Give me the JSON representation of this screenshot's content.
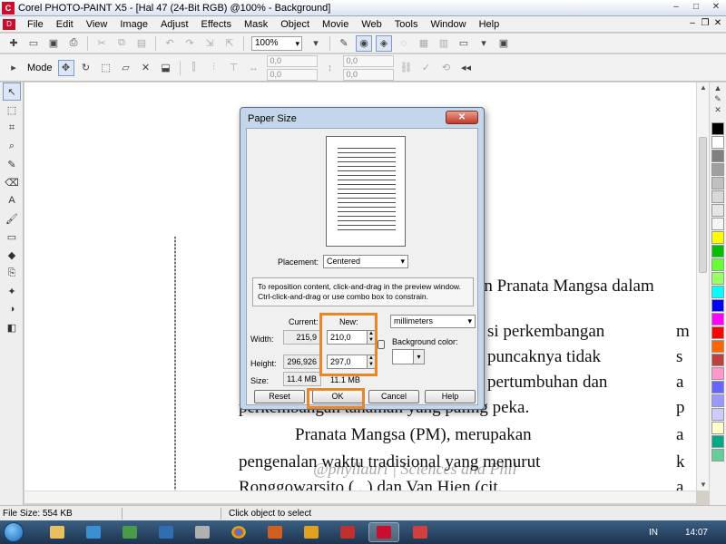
{
  "window": {
    "title": "Corel PHOTO-PAINT X5 - [Hal 47 (24-Bit RGB) @100% - Background]",
    "minimize": "–",
    "maximize": "□",
    "close": "✕"
  },
  "menubar": {
    "items": [
      "File",
      "Edit",
      "View",
      "Image",
      "Adjust",
      "Effects",
      "Mask",
      "Object",
      "Movie",
      "Web",
      "Tools",
      "Window",
      "Help"
    ]
  },
  "toolbar": {
    "zoom": "100%"
  },
  "property_bar": {
    "mode_label": "Mode",
    "x_value": "0,0",
    "y_value": "0,0",
    "w_value": "0,0",
    "h_value": "0,0"
  },
  "document": {
    "lines": [
      "an Pranata Mangsa dalam",
      "si perkembangan",
      "puncaknya tidak",
      "pertumbuhan dan",
      "perkembangan tanaman yang paling peka.",
      "Pranata  Mangsa  (PM),  merupakan",
      "pengenalan  waktu  tradisional  yang  menurut",
      "Ronggowarsito  ( . )  dan  Van  Hien  (cit."
    ],
    "right_column": [
      "m",
      "s",
      "a",
      "p",
      "a",
      "k",
      "a"
    ],
    "watermark": "@phyllauri | Sciences and Phil"
  },
  "dialog": {
    "title": "Paper Size",
    "close": "✕",
    "placement_label": "Placement:",
    "placement_value": "Centered",
    "info_text": "To reposition content, click-and-drag in the preview window. Ctrl-click-and-drag or use combo box to constrain.",
    "current_label": "Current:",
    "new_label": "New:",
    "units_value": "millimeters",
    "width_label": "Width:",
    "height_label": "Height:",
    "size_label": "Size:",
    "current_width": "215,9",
    "current_height": "296,926",
    "current_size": "11.4 MB",
    "new_width": "210,0",
    "new_height": "297,0",
    "new_size": "11.1 MB",
    "background_color_label": "Background color:",
    "buttons": {
      "reset": "Reset",
      "ok": "OK",
      "cancel": "Cancel",
      "help": "Help"
    },
    "highlight_color": "#e8862a"
  },
  "statusbar": {
    "file_size": "File Size: 554 KB",
    "hint": "Click object to select"
  },
  "taskbar": {
    "language": "IN",
    "time": "14:07"
  },
  "palette": {
    "colors": [
      "#000000",
      "#ffffff",
      "#808080",
      "#a0a0a0",
      "#c0c0c0",
      "#d8d8d8",
      "#e6e6e6",
      "#f5f5f5",
      "#fffb00",
      "#00c000",
      "#66ff33",
      "#99ff66",
      "#00ffff",
      "#0000ff",
      "#ff00ff",
      "#ff0000",
      "#ff6600",
      "#c04040",
      "#ff99cc",
      "#6666ff",
      "#9999ff",
      "#ccccff",
      "#ffffcc",
      "#00aa88",
      "#66cc99"
    ]
  }
}
